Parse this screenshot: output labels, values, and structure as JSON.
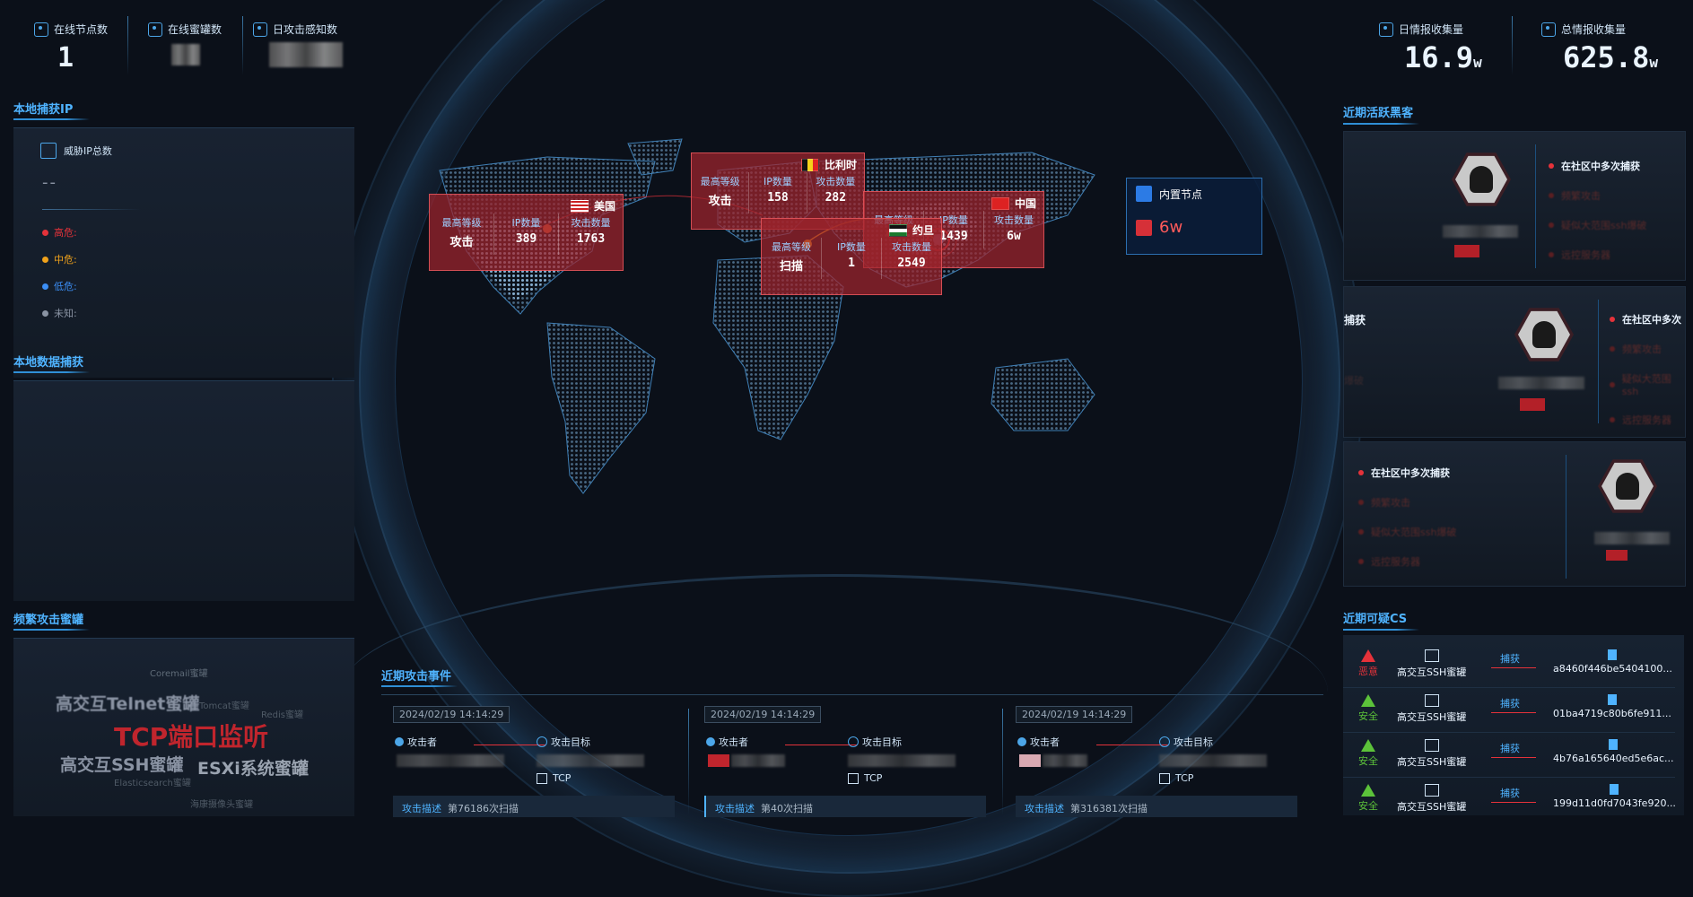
{
  "top_left_stats": [
    {
      "label": "在线节点数",
      "value": "1",
      "icon": "location-icon"
    },
    {
      "label": "在线蜜罐数",
      "value": "",
      "icon": "honeypot-icon"
    },
    {
      "label": "日攻击感知数",
      "value": "",
      "icon": "shield-icon"
    }
  ],
  "top_right_stats": [
    {
      "label": "日情报收集量",
      "value": "16.9",
      "unit": "w",
      "icon": "intel-icon"
    },
    {
      "label": "总情报收集量",
      "value": "625.8",
      "unit": "w",
      "icon": "intel-total-icon"
    }
  ],
  "local_ip": {
    "title": "本地捕获IP",
    "threat_label": "威胁IP总数",
    "threat_value": "--",
    "legend": [
      {
        "label": "高危:",
        "color": "#e5323a"
      },
      {
        "label": "中危:",
        "color": "#f0a21b"
      },
      {
        "label": "低危:",
        "color": "#3b8ef5"
      },
      {
        "label": "未知:",
        "color": "#8a93a3"
      }
    ]
  },
  "local_data": {
    "title": "本地数据捕获"
  },
  "honeypot_cloud": {
    "title": "频繁攻击蜜罐",
    "words": [
      {
        "text": "Coremail蜜罐"
      },
      {
        "text": "高交互Telnet蜜罐"
      },
      {
        "text": "Tomcat蜜罐"
      },
      {
        "text": "Redis蜜罐"
      },
      {
        "text": "TCP端口监听"
      },
      {
        "text": "高交互SSH蜜罐"
      },
      {
        "text": "ESXi系统蜜罐"
      },
      {
        "text": "Elasticsearch蜜罐"
      },
      {
        "text": "海康摄像头蜜罐"
      }
    ]
  },
  "map": {
    "countries": [
      {
        "name": "美国",
        "flag": "us",
        "level_label": "最高等级",
        "level": "攻击",
        "ip_label": "IP数量",
        "ip": "389",
        "attack_label": "攻击数量",
        "attack": "1763"
      },
      {
        "name": "比利时",
        "flag": "be",
        "level_label": "最高等级",
        "level": "攻击",
        "ip_label": "IP数量",
        "ip": "158",
        "attack_label": "攻击数量",
        "attack": "282"
      },
      {
        "name": "中国",
        "flag": "cn",
        "level_label": "最高等级",
        "level": "",
        "ip_label": "IP数量",
        "ip": "1439",
        "attack_label": "攻击数量",
        "attack": "6w"
      },
      {
        "name": "约旦",
        "flag": "jo",
        "level_label": "最高等级",
        "level": "扫描",
        "ip_label": "IP数量",
        "ip": "1",
        "attack_label": "攻击数量",
        "attack": "2549"
      }
    ],
    "node_label": "内置节点",
    "node_value": "6w"
  },
  "recent_events": {
    "title": "近期攻击事件",
    "events": [
      {
        "date": "2024/02/19 14:14:29",
        "attacker": "攻击者",
        "target": "攻击目标",
        "proto": "TCP",
        "desc_label": "攻击描述",
        "desc": "第76186次扫描"
      },
      {
        "date": "2024/02/19 14:14:29",
        "attacker": "攻击者",
        "target": "攻击目标",
        "proto": "TCP",
        "desc_label": "攻击描述",
        "desc": "第40次扫描"
      },
      {
        "date": "2024/02/19 14:14:29",
        "attacker": "攻击者",
        "target": "攻击目标",
        "proto": "TCP",
        "desc_label": "攻击描述",
        "desc": "第316381次扫描"
      }
    ]
  },
  "active_hackers": {
    "title": "近期活跃黑客",
    "cards": [
      {
        "items": [
          "在社区中多次捕获",
          "频繁攻击",
          "疑似大范围ssh爆破",
          "远控服务器"
        ]
      },
      {
        "items": [
          "在社区中多次",
          "频繁攻击",
          "疑似大范围ssh",
          "远控服务器"
        ],
        "left": [
          "捕获",
          "爆破"
        ]
      },
      {
        "items": [
          "在社区中多次捕获",
          "频繁攻击",
          "疑似大范围ssh爆破",
          "远控服务器"
        ]
      }
    ]
  },
  "suspicious_cs": {
    "title": "近期可疑CS",
    "rows": [
      {
        "status": "恶意",
        "status_color": "#e5323a",
        "type": "高交互SSH蜜罐",
        "action": "捕获",
        "hash": "a8460f446be5404100..."
      },
      {
        "status": "安全",
        "status_color": "#5cc23a",
        "type": "高交互SSH蜜罐",
        "action": "捕获",
        "hash": "01ba4719c80b6fe911..."
      },
      {
        "status": "安全",
        "status_color": "#5cc23a",
        "type": "高交互SSH蜜罐",
        "action": "捕获",
        "hash": "4b76a165640ed5e6ac..."
      },
      {
        "status": "安全",
        "status_color": "#5cc23a",
        "type": "高交互SSH蜜罐",
        "action": "捕获",
        "hash": "199d11d0fd7043fe920..."
      }
    ]
  }
}
